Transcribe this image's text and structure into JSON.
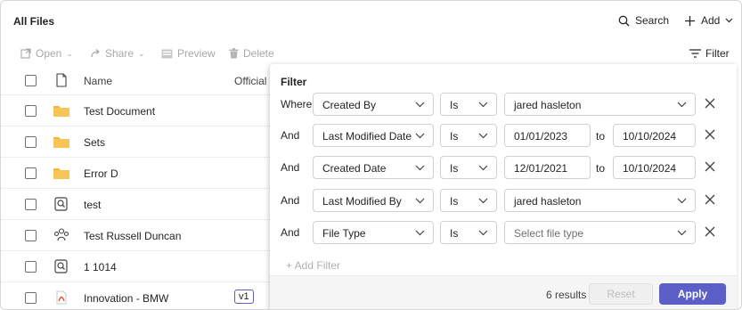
{
  "header": {
    "title": "All Files",
    "search_label": "Search",
    "add_label": "Add"
  },
  "toolbar": {
    "open_label": "Open",
    "share_label": "Share",
    "preview_label": "Preview",
    "delete_label": "Delete",
    "filter_label": "Filter"
  },
  "table": {
    "columns": {
      "name": "Name",
      "official": "Official"
    },
    "rows": [
      {
        "name": "Test Document",
        "icon": "folder-icon"
      },
      {
        "name": "Sets",
        "icon": "folder-icon"
      },
      {
        "name": "Error D",
        "icon": "folder-icon"
      },
      {
        "name": "test",
        "icon": "search-doc-icon"
      },
      {
        "name": "Test Russell Duncan",
        "icon": "people-icon"
      },
      {
        "name": "1 1014",
        "icon": "search-doc-icon"
      },
      {
        "name": "Innovation - BMW",
        "icon": "pdf-icon",
        "badge": "v1"
      }
    ]
  },
  "filter": {
    "title": "Filter",
    "rows": [
      {
        "conjunction": "Where",
        "field": "Created By",
        "operator": "Is",
        "value": "jared hasleton"
      },
      {
        "conjunction": "And",
        "field": "Last Modified Date",
        "operator": "Is",
        "from": "01/01/2023",
        "to_label": "to",
        "to": "10/10/2024"
      },
      {
        "conjunction": "And",
        "field": "Created Date",
        "operator": "Is",
        "from": "12/01/2021",
        "to_label": "to",
        "to": "10/10/2024"
      },
      {
        "conjunction": "And",
        "field": "Last Modified By",
        "operator": "Is",
        "value": "jared hasleton"
      },
      {
        "conjunction": "And",
        "field": "File Type",
        "operator": "Is",
        "placeholder": "Select file type"
      }
    ],
    "add_filter_label": "+ Add Filter",
    "results": "6 results",
    "reset_label": "Reset",
    "apply_label": "Apply"
  },
  "colors": {
    "accent": "#5b5fc7",
    "folder": "#f3b73d",
    "pdf": "#e0533d"
  }
}
